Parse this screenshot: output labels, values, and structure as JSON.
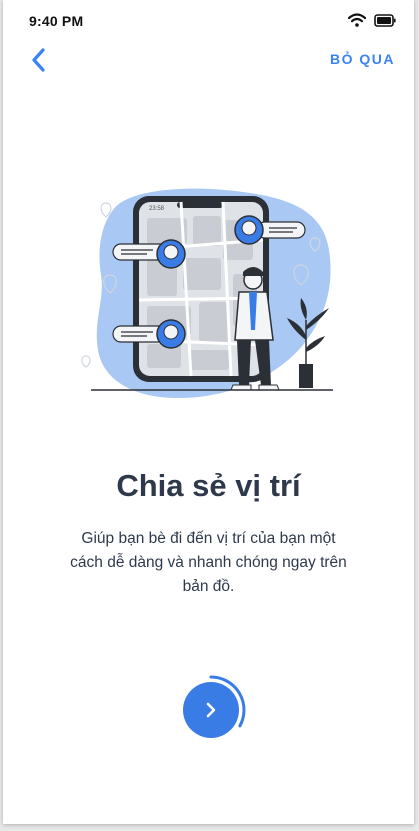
{
  "status_bar": {
    "time": "9:40 PM"
  },
  "nav": {
    "skip_label": "BỎ QUA"
  },
  "onboarding": {
    "title": "Chia sẻ vị trí",
    "description": "Giúp bạn bè đi đến vị trí của bạn một cách dễ dàng và nhanh chóng ngay trên bản đồ.",
    "phone_time": "23:58",
    "progress": 0.33
  },
  "colors": {
    "accent": "#3a7ce6",
    "title": "#2e3a4b",
    "blob": "#a9c8f3"
  }
}
